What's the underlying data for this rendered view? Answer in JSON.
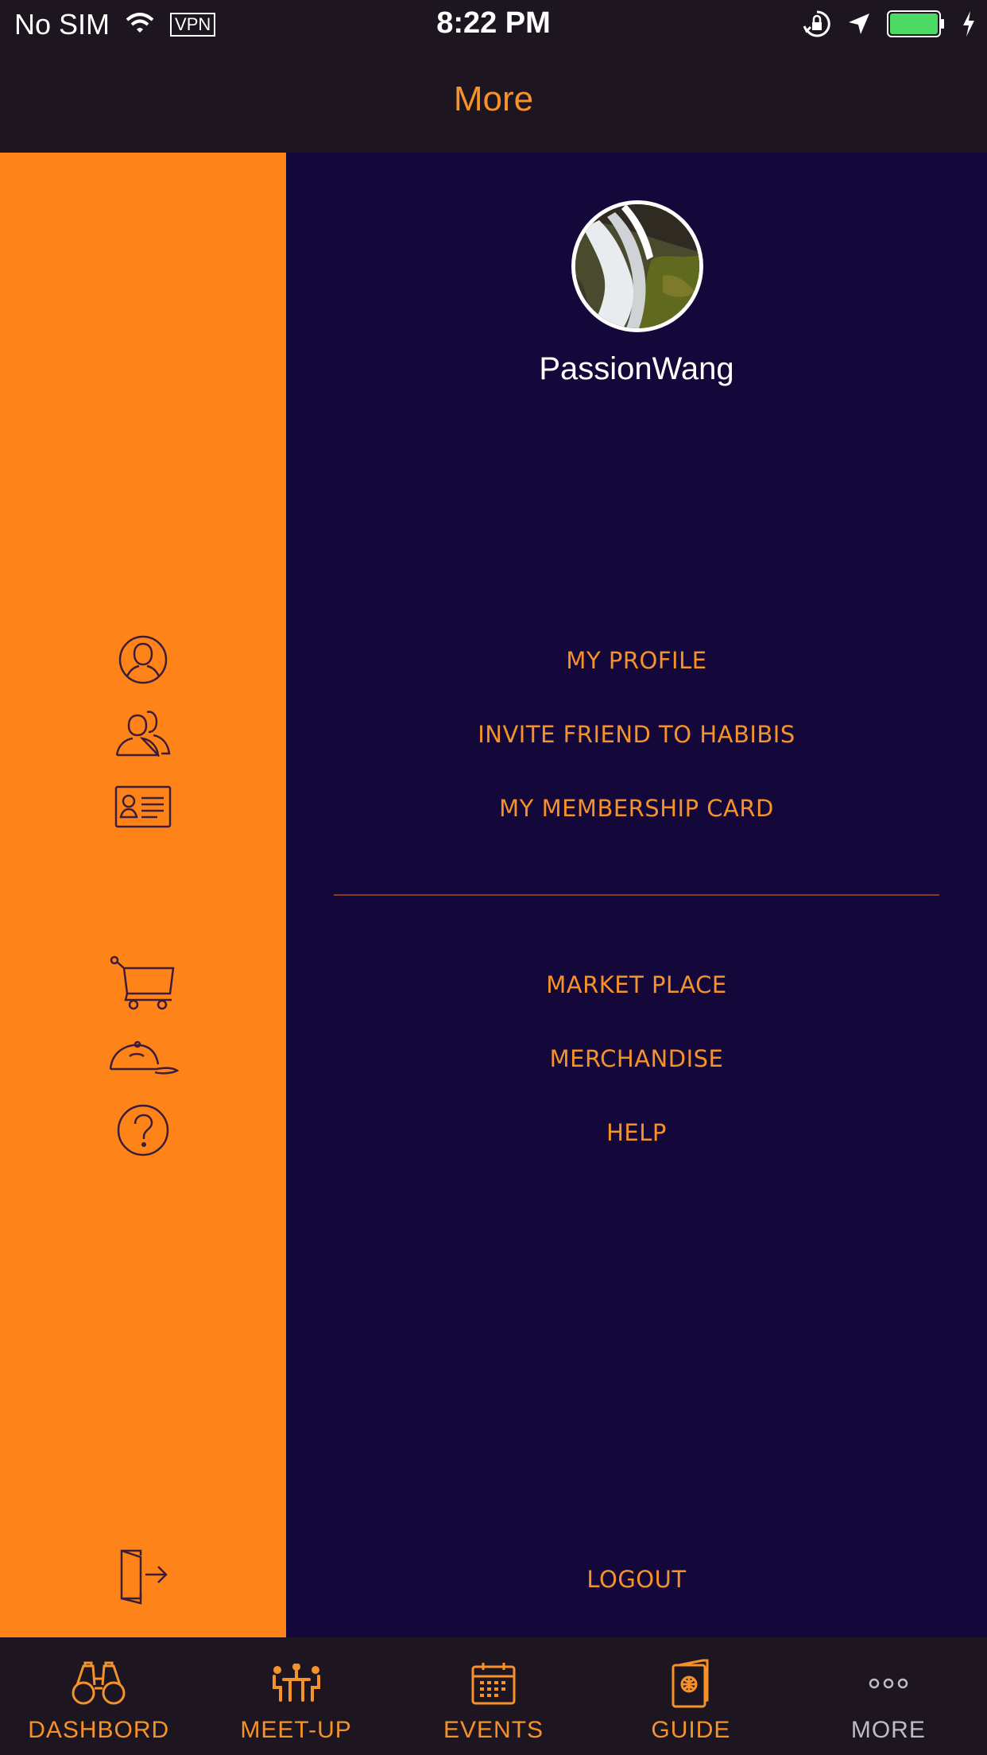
{
  "status_bar": {
    "carrier": "No SIM",
    "vpn": "VPN",
    "time": "8:22 PM",
    "battery_color": "#4cd964"
  },
  "nav": {
    "title": "More"
  },
  "profile": {
    "username": "PassionWang"
  },
  "menu": {
    "my_profile": "MY PROFILE",
    "invite_friend": "INVITE FRIEND TO HABIBIS",
    "membership_card": "MY MEMBERSHIP CARD",
    "market_place": "MARKET PLACE",
    "merchandise": "MERCHANDISE",
    "help": "HELP",
    "logout": "LOGOUT"
  },
  "rail_icons": [
    "user-icon",
    "friends-icon",
    "id-card-icon",
    "cart-icon",
    "cap-icon",
    "help-icon",
    "logout-icon"
  ],
  "tabs": [
    {
      "label": "DASHBORD",
      "icon": "binoculars-icon"
    },
    {
      "label": "MEET-UP",
      "icon": "meetup-icon"
    },
    {
      "label": "EVENTS",
      "icon": "calendar-icon"
    },
    {
      "label": "GUIDE",
      "icon": "passport-icon"
    },
    {
      "label": "MORE",
      "icon": "more-dots-icon"
    }
  ],
  "colors": {
    "accent": "#f5922a",
    "rail": "#fe8419",
    "panel": "#14073a",
    "bars": "#1d1620",
    "divider": "#8a3b23"
  }
}
